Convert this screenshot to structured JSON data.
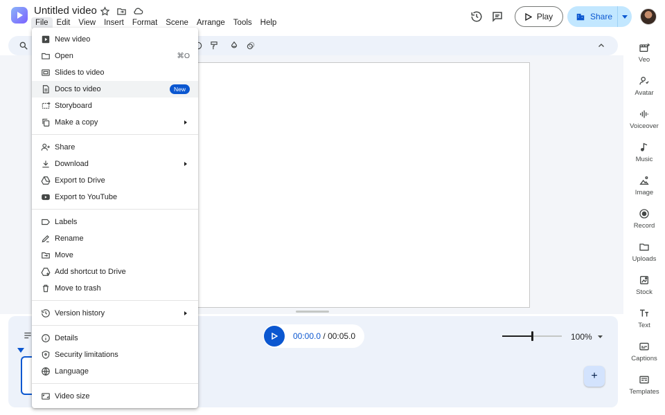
{
  "app": {
    "title": "Untitled video"
  },
  "menubar": [
    "File",
    "Edit",
    "View",
    "Insert",
    "Format",
    "Scene",
    "Arrange",
    "Tools",
    "Help"
  ],
  "top_actions": {
    "play_label": "Play",
    "share_label": "Share"
  },
  "file_menu": {
    "groups": [
      [
        {
          "label": "New video",
          "icon": "video-icon"
        },
        {
          "label": "Open",
          "icon": "folder-icon",
          "shortcut": "⌘O"
        },
        {
          "label": "Slides to video",
          "icon": "slides-icon"
        },
        {
          "label": "Docs to video",
          "icon": "doc-icon",
          "badge": "New"
        },
        {
          "label": "Storyboard",
          "icon": "storyboard-icon"
        },
        {
          "label": "Make a copy",
          "icon": "copy-icon",
          "submenu": true
        }
      ],
      [
        {
          "label": "Share",
          "icon": "person-add-icon"
        },
        {
          "label": "Download",
          "icon": "download-icon",
          "submenu": true
        },
        {
          "label": "Export to Drive",
          "icon": "drive-icon"
        },
        {
          "label": "Export to YouTube",
          "icon": "youtube-icon"
        }
      ],
      [
        {
          "label": "Labels",
          "icon": "label-icon"
        },
        {
          "label": "Rename",
          "icon": "pencil-icon"
        },
        {
          "label": "Move",
          "icon": "move-folder-icon"
        },
        {
          "label": "Add shortcut to Drive",
          "icon": "drive-shortcut-icon"
        },
        {
          "label": "Move to trash",
          "icon": "trash-icon"
        }
      ],
      [
        {
          "label": "Version history",
          "icon": "history-icon",
          "submenu": true
        }
      ],
      [
        {
          "label": "Details",
          "icon": "info-icon"
        },
        {
          "label": "Security limitations",
          "icon": "shield-icon"
        },
        {
          "label": "Language",
          "icon": "globe-icon"
        }
      ],
      [
        {
          "label": "Video size",
          "icon": "aspect-ratio-icon"
        }
      ]
    ]
  },
  "playback": {
    "current": "00:00.0",
    "separator": " / ",
    "total": "00:05.0"
  },
  "zoom": {
    "label": "100%",
    "level": 0.5
  },
  "right_rail": [
    "Veo",
    "Avatar",
    "Voiceover",
    "Music",
    "Image",
    "Record",
    "Uploads",
    "Stock",
    "Text",
    "Captions",
    "Templates"
  ],
  "colors": {
    "accent": "#0b57d0",
    "share_bg": "#c2e7ff",
    "toolbar_bg": "#edf2fa"
  }
}
